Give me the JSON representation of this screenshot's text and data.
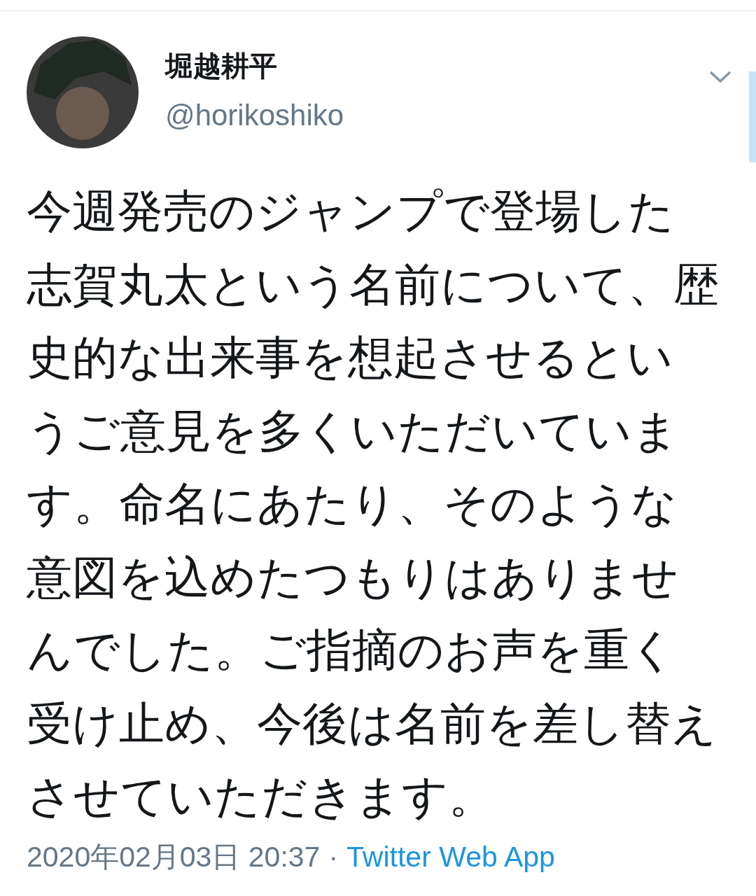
{
  "tweet": {
    "display_name": "堀越耕平",
    "handle": "@horikoshiko",
    "text": "今週発売のジャンプで登場した志賀丸太という名前について、歴史的な出来事を想起させるというご意見を多くいただいています。命名にあたり、そのような意図を込めたつもりはありませんでした。ご指摘のお声を重く受け止め、今後は名前を差し替えさせていただきます。",
    "timestamp": "2020年02月03日 20:37",
    "separator": "·",
    "source": "Twitter Web App"
  }
}
